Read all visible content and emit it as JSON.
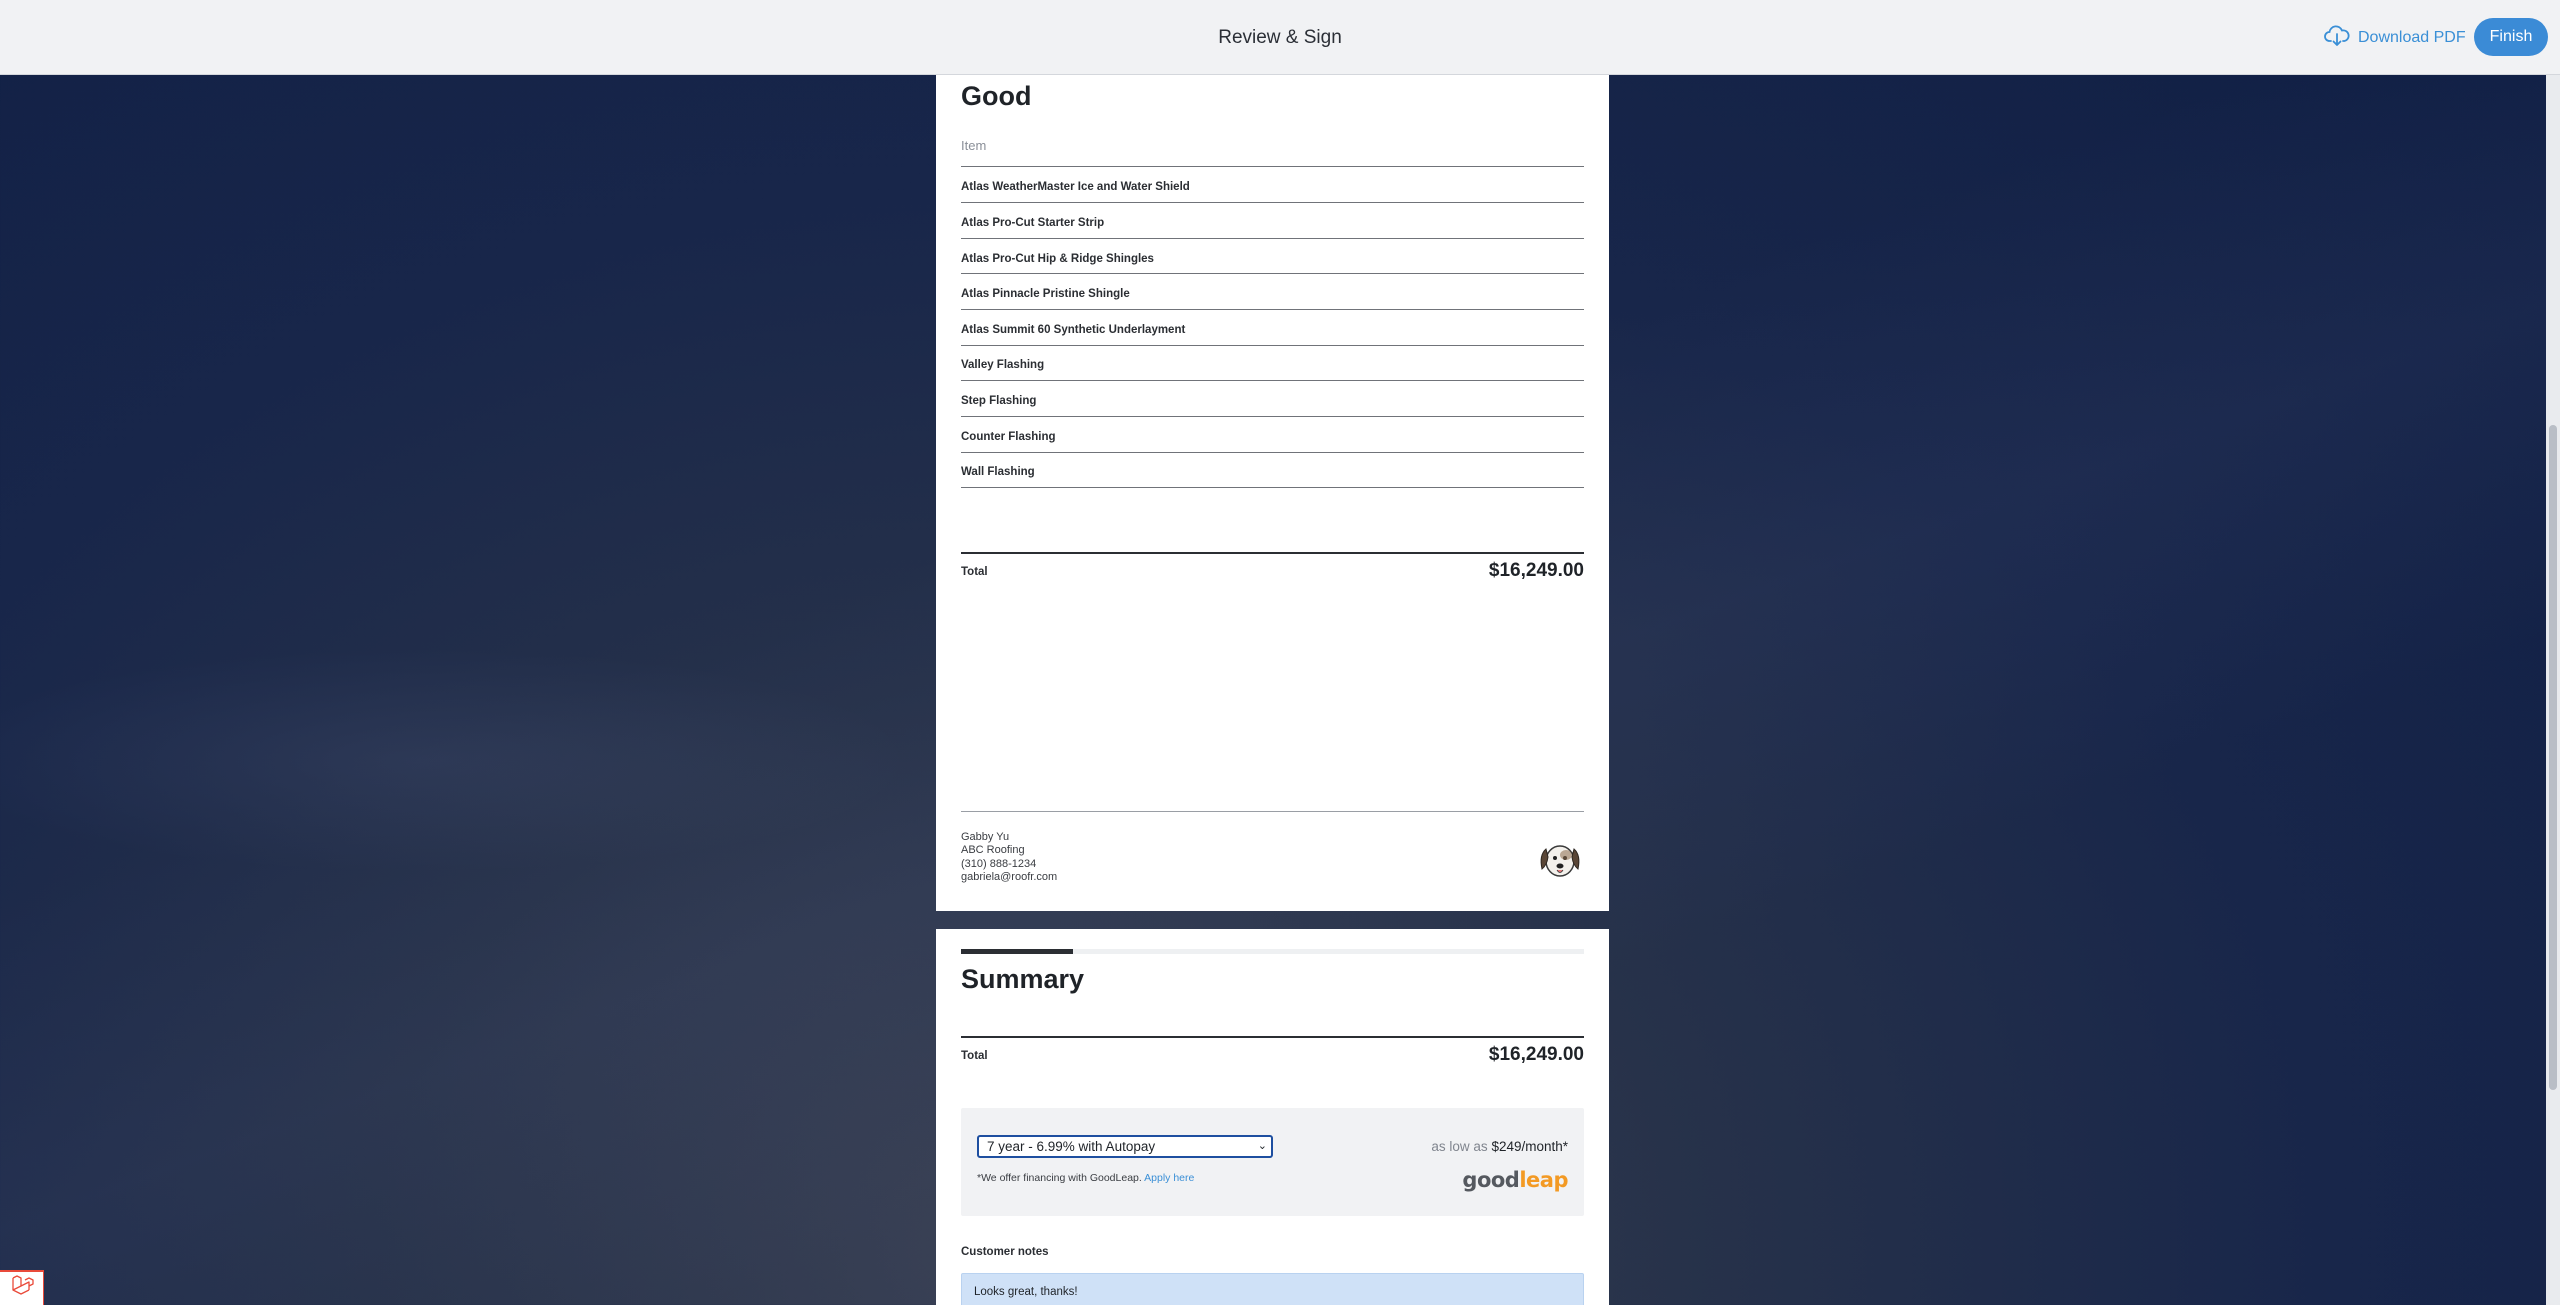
{
  "topbar": {
    "title": "Review & Sign",
    "download_label": "Download PDF",
    "finish_label": "Finish"
  },
  "option": {
    "title": "Good",
    "item_header": "Item",
    "items": [
      "Atlas WeatherMaster Ice and Water Shield",
      "Atlas Pro-Cut Starter Strip",
      "Atlas Pro-Cut Hip & Ridge Shingles",
      "Atlas Pinnacle Pristine Shingle",
      "Atlas Summit 60 Synthetic Underlayment",
      "Valley Flashing",
      "Step Flashing",
      "Counter Flashing",
      "Wall Flashing"
    ],
    "total_label": "Total",
    "total_value": "$16,249.00"
  },
  "contact": {
    "name": "Gabby Yu",
    "company": "ABC Roofing",
    "phone": "(310) 888-1234",
    "email": "gabriela@roofr.com"
  },
  "summary": {
    "title": "Summary",
    "total_label": "Total",
    "total_value": "$16,249.00",
    "financing": {
      "selected_option": "7 year - 6.99% with Autopay",
      "as_low_as_prefix": "as low as",
      "monthly_amount": "$249/month*",
      "note": "*We offer financing with GoodLeap.",
      "apply_link": "Apply here",
      "brand_good": "good",
      "brand_leap": "leap"
    },
    "notes_label": "Customer notes",
    "notes_text": "Looks great, thanks!"
  }
}
